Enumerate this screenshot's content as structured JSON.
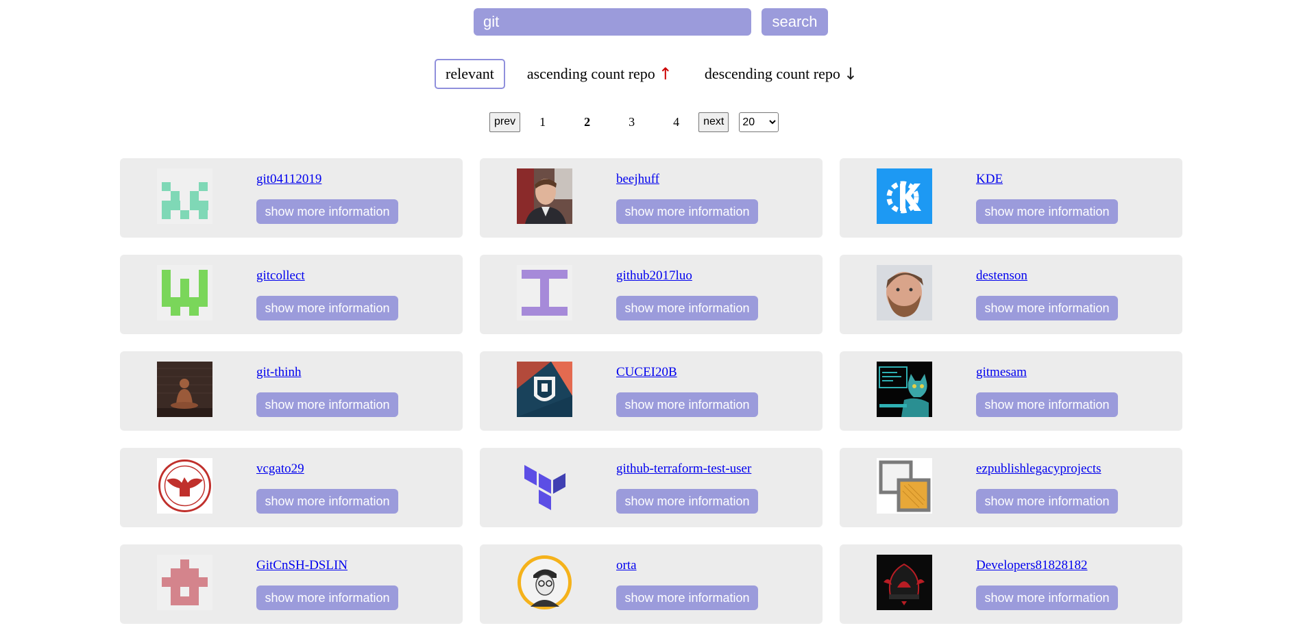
{
  "search": {
    "value": "git",
    "button_label": "search"
  },
  "sort": {
    "options": [
      {
        "label": "relevant",
        "arrow": ""
      },
      {
        "label": "ascending count repo",
        "arrow": "↑"
      },
      {
        "label": "descending count repo",
        "arrow": "↓"
      }
    ],
    "active": "relevant"
  },
  "pagination": {
    "prev_label": "prev",
    "next_label": "next",
    "pages": [
      "1",
      "2",
      "3",
      "4"
    ],
    "current_page": "2",
    "per_page": "20"
  },
  "button_label": "show more information",
  "colors": {
    "accent": "#9b9bdb",
    "card_bg": "#ececec",
    "link": "#0000ee"
  },
  "users": [
    {
      "login": "git04112019",
      "avatar": "identicon-teal-icon"
    },
    {
      "login": "beejhuff",
      "avatar": "photo-man-portrait-icon"
    },
    {
      "login": "KDE",
      "avatar": "kde-logo-icon"
    },
    {
      "login": "gitcollect",
      "avatar": "identicon-green-icon"
    },
    {
      "login": "github2017luo",
      "avatar": "identicon-purple-icon"
    },
    {
      "login": "destenson",
      "avatar": "photo-bearded-man-icon"
    },
    {
      "login": "git-thinh",
      "avatar": "photo-buddha-statue-icon"
    },
    {
      "login": "CUCEI20B",
      "avatar": "university-crest-icon"
    },
    {
      "login": "gitmesam",
      "avatar": "cat-at-computer-icon"
    },
    {
      "login": "vcgato29",
      "avatar": "red-eagle-seal-icon"
    },
    {
      "login": "github-terraform-test-user",
      "avatar": "terraform-logo-icon"
    },
    {
      "login": "ezpublishlegacyprojects",
      "avatar": "stacked-frames-icon"
    },
    {
      "login": "GitCnSH-DSLIN",
      "avatar": "identicon-pink-icon"
    },
    {
      "login": "orta",
      "avatar": "cartoon-man-portrait-icon"
    },
    {
      "login": "Developers81828182",
      "avatar": "dark-hooded-logo-icon"
    }
  ]
}
